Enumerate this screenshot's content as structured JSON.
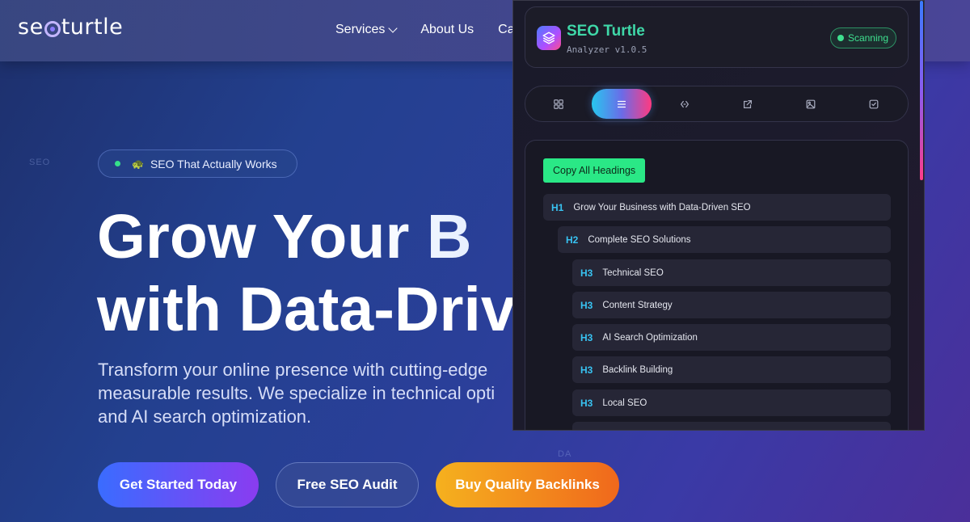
{
  "site": {
    "logo_text_start": "se",
    "logo_text_end": "turtle",
    "nav": [
      {
        "label": "Services"
      },
      {
        "label": "About Us"
      },
      {
        "label": "Ca"
      }
    ],
    "bg_labels": [
      "SEO",
      "DA"
    ],
    "badge_text": "SEO That Actually Works",
    "badge_icon": "🐢",
    "hero_line1": "Grow Your B",
    "hero_line2": "with Data-Driver",
    "hero_desc_lines": [
      "Transform your online presence with cutting-edge",
      "measurable results. We specialize in technical opti",
      "and AI search optimization."
    ],
    "buttons": {
      "primary": "Get Started Today",
      "secondary": "Free SEO Audit",
      "orange": "Buy Quality Backlinks"
    }
  },
  "extension": {
    "title": "SEO Turtle",
    "version": "Analyzer v1.0.5",
    "status": "Scanning",
    "colors": {
      "accent": "#3fd8a8",
      "status": "#3ee08f",
      "heading_level": "#38c3f2",
      "copy_button": "#2ae886"
    },
    "tabs": [
      {
        "icon": "grid-icon",
        "active": false
      },
      {
        "icon": "list-icon",
        "active": true
      },
      {
        "icon": "link-icon",
        "active": false
      },
      {
        "icon": "external-link-icon",
        "active": false
      },
      {
        "icon": "image-icon",
        "active": false
      },
      {
        "icon": "checkbox-icon",
        "active": false
      }
    ],
    "copy_button": "Copy All Headings",
    "headings": [
      {
        "level": "H1",
        "text": "Grow Your Business with Data-Driven SEO"
      },
      {
        "level": "H2",
        "text": "Complete SEO Solutions"
      },
      {
        "level": "H3",
        "text": "Technical SEO"
      },
      {
        "level": "H3",
        "text": "Content Strategy"
      },
      {
        "level": "H3",
        "text": "AI Search Optimization"
      },
      {
        "level": "H3",
        "text": "Backlink Building"
      },
      {
        "level": "H3",
        "text": "Local SEO"
      }
    ]
  }
}
